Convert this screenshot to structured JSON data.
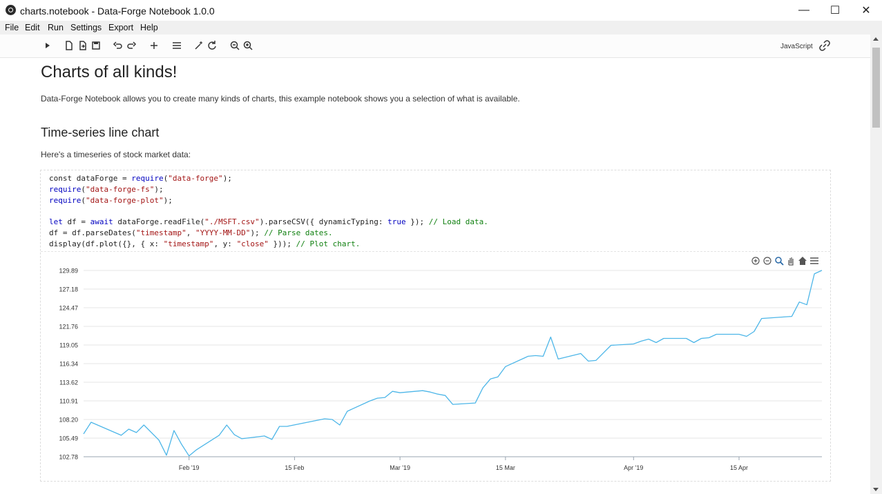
{
  "window": {
    "title": "charts.notebook - Data-Forge Notebook 1.0.0",
    "minimize": "—",
    "maximize": "☐",
    "close": "✕"
  },
  "menu": [
    "File",
    "Edit",
    "Run",
    "Settings",
    "Export",
    "Help"
  ],
  "toolbar": {
    "language": "JavaScript"
  },
  "doc": {
    "title": "Charts of all kinds!",
    "intro": "Data-Forge Notebook allows you to create many kinds of charts, this example notebook shows you a selection of what is available.",
    "section_title": "Time-series line chart",
    "section_intro": "Here's a timeseries of stock market data:"
  },
  "code_lines": [
    [
      [
        "const dataForge = ",
        ""
      ],
      [
        "require",
        "kw"
      ],
      [
        "(",
        ""
      ],
      [
        "\"data-forge\"",
        "str"
      ],
      [
        ");",
        ""
      ]
    ],
    [
      [
        "require",
        "kw"
      ],
      [
        "(",
        ""
      ],
      [
        "\"data-forge-fs\"",
        "str"
      ],
      [
        ");",
        ""
      ]
    ],
    [
      [
        "require",
        "kw"
      ],
      [
        "(",
        ""
      ],
      [
        "\"data-forge-plot\"",
        "str"
      ],
      [
        ");",
        ""
      ]
    ],
    [
      [
        "",
        ""
      ]
    ],
    [
      [
        "let",
        "kw"
      ],
      [
        " df = ",
        ""
      ],
      [
        "await",
        "kw"
      ],
      [
        " dataForge.readFile(",
        ""
      ],
      [
        "\"./MSFT.csv\"",
        "str"
      ],
      [
        ").parseCSV({ dynamicTyping: ",
        ""
      ],
      [
        "true",
        "kw"
      ],
      [
        " }); ",
        ""
      ],
      [
        "// Load data.",
        "cm"
      ]
    ],
    [
      [
        "df = df.parseDates(",
        ""
      ],
      [
        "\"timestamp\"",
        "str"
      ],
      [
        ", ",
        ""
      ],
      [
        "\"YYYY-MM-DD\"",
        "str"
      ],
      [
        "); ",
        ""
      ],
      [
        "// Parse dates.",
        "cm"
      ]
    ],
    [
      [
        "display(df.plot({}, { x: ",
        ""
      ],
      [
        "\"timestamp\"",
        "str"
      ],
      [
        ", y: ",
        ""
      ],
      [
        "\"close\"",
        "str"
      ],
      [
        " })); ",
        ""
      ],
      [
        "// Plot chart.",
        "cm"
      ]
    ]
  ],
  "chart_data": {
    "type": "line",
    "x_start": "2019-01-18",
    "x_end": "2019-04-26",
    "ylim": [
      102.78,
      129.89
    ],
    "y_ticks": [
      "129.89",
      "127.18",
      "124.47",
      "121.76",
      "119.05",
      "116.34",
      "113.62",
      "110.91",
      "108.20",
      "105.49",
      "102.78"
    ],
    "x_tick_labels": [
      {
        "date": "2019-02-01",
        "label": "Feb '19"
      },
      {
        "date": "2019-02-15",
        "label": "15 Feb"
      },
      {
        "date": "2019-03-01",
        "label": "Mar '19"
      },
      {
        "date": "2019-03-15",
        "label": "15 Mar"
      },
      {
        "date": "2019-04-01",
        "label": "Apr '19"
      },
      {
        "date": "2019-04-15",
        "label": "15 Apr"
      }
    ],
    "series": [
      {
        "color": "#4db6e8",
        "x": [
          "2019-01-18",
          "2019-01-19",
          "2019-01-23",
          "2019-01-24",
          "2019-01-25",
          "2019-01-26",
          "2019-01-28",
          "2019-01-29",
          "2019-01-30",
          "2019-01-31",
          "2019-02-01",
          "2019-02-02",
          "2019-02-05",
          "2019-02-06",
          "2019-02-07",
          "2019-02-08",
          "2019-02-11",
          "2019-02-12",
          "2019-02-13",
          "2019-02-14",
          "2019-02-19",
          "2019-02-20",
          "2019-02-21",
          "2019-02-22",
          "2019-02-25",
          "2019-02-26",
          "2019-02-27",
          "2019-02-28",
          "2019-03-01",
          "2019-03-04",
          "2019-03-05",
          "2019-03-06",
          "2019-03-07",
          "2019-03-08",
          "2019-03-11",
          "2019-03-12",
          "2019-03-13",
          "2019-03-14",
          "2019-03-15",
          "2019-03-18",
          "2019-03-19",
          "2019-03-20",
          "2019-03-21",
          "2019-03-22",
          "2019-03-25",
          "2019-03-26",
          "2019-03-27",
          "2019-03-28",
          "2019-03-29",
          "2019-04-01",
          "2019-04-02",
          "2019-04-03",
          "2019-04-04",
          "2019-04-05",
          "2019-04-08",
          "2019-04-09",
          "2019-04-10",
          "2019-04-11",
          "2019-04-12",
          "2019-04-15",
          "2019-04-16",
          "2019-04-17",
          "2019-04-18",
          "2019-04-22",
          "2019-04-23",
          "2019-04-24",
          "2019-04-25",
          "2019-04-26"
        ],
        "y": [
          106.1,
          107.8,
          105.9,
          106.8,
          106.3,
          107.4,
          105.2,
          103.0,
          106.6,
          104.6,
          102.9,
          103.8,
          105.9,
          107.4,
          106.0,
          105.4,
          105.8,
          105.3,
          107.2,
          107.2,
          108.3,
          108.2,
          107.4,
          109.4,
          110.9,
          111.3,
          111.4,
          112.3,
          112.1,
          112.4,
          112.2,
          111.9,
          111.7,
          110.4,
          110.6,
          112.8,
          114.1,
          114.4,
          115.9,
          117.4,
          117.5,
          117.4,
          120.2,
          117.0,
          117.8,
          116.7,
          116.8,
          117.9,
          119.0,
          119.2,
          119.6,
          119.9,
          119.4,
          120.0,
          120.0,
          119.4,
          120.0,
          120.1,
          120.6,
          120.6,
          120.3,
          121.0,
          122.9,
          123.2,
          125.3,
          124.9,
          129.4,
          129.9
        ]
      }
    ]
  }
}
